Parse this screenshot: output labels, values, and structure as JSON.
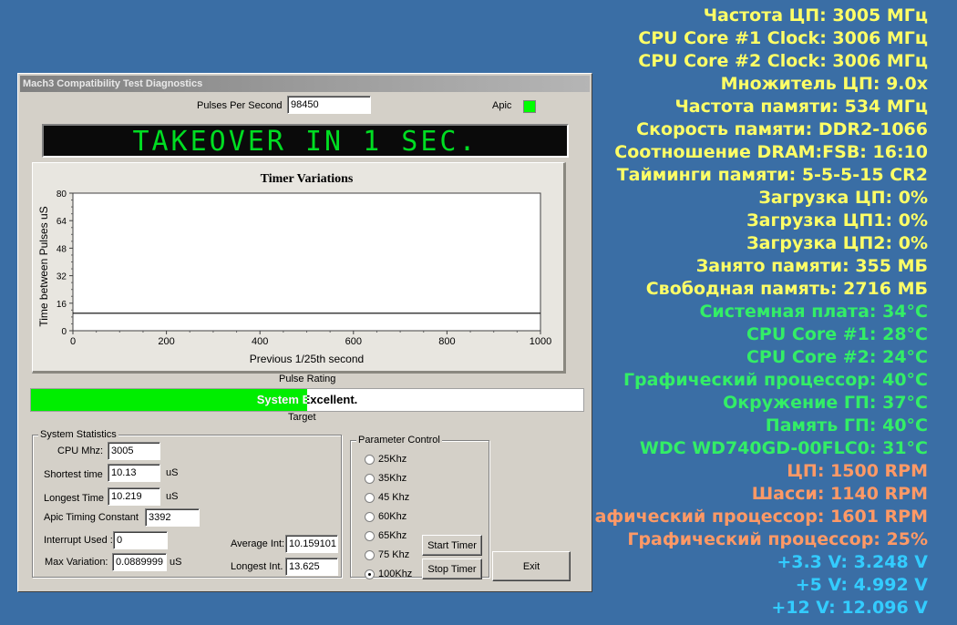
{
  "overlay": {
    "lines": [
      {
        "text": "Частота ЦП: 3005 МГц",
        "color": "#ffff66"
      },
      {
        "text": "CPU Core #1 Clock: 3006 МГц",
        "color": "#ffff66"
      },
      {
        "text": "CPU Core #2 Clock: 3006 МГц",
        "color": "#ffff66"
      },
      {
        "text": "Множитель ЦП: 9.0x",
        "color": "#ffff66"
      },
      {
        "text": "Частота памяти: 534 МГц",
        "color": "#ffff66"
      },
      {
        "text": "Скорость памяти: DDR2-1066",
        "color": "#ffff66"
      },
      {
        "text": "Соотношение DRAM:FSB: 16:10",
        "color": "#ffff66"
      },
      {
        "text": "Тайминги памяти: 5-5-5-15 CR2",
        "color": "#ffff66"
      },
      {
        "text": "Загрузка ЦП: 0%",
        "color": "#ffff66"
      },
      {
        "text": "Загрузка ЦП1: 0%",
        "color": "#ffff66"
      },
      {
        "text": "Загрузка ЦП2: 0%",
        "color": "#ffff66"
      },
      {
        "text": "Занято памяти: 355 МБ",
        "color": "#ffff66"
      },
      {
        "text": "Свободная память: 2716 МБ",
        "color": "#ffff66"
      },
      {
        "text": "Системная плата: 34°C",
        "color": "#33ee66"
      },
      {
        "text": "CPU Core #1: 28°C",
        "color": "#33ee66"
      },
      {
        "text": "CPU Core #2: 24°C",
        "color": "#33ee66"
      },
      {
        "text": "Графический процессор: 40°C",
        "color": "#33ee66"
      },
      {
        "text": "Окружение ГП: 37°C",
        "color": "#33ee66"
      },
      {
        "text": "Память ГП: 40°C",
        "color": "#33ee66"
      },
      {
        "text": "WDC WD740GD-00FLC0: 31°C",
        "color": "#33ee66"
      },
      {
        "text": "ЦП: 1500 RPM",
        "color": "#ff9966"
      },
      {
        "text": "Шасси: 1140 RPM",
        "color": "#ff9966"
      },
      {
        "text": "афический процессор: 1601 RPM",
        "color": "#ff9966"
      },
      {
        "text": "Графический процессор: 25%",
        "color": "#ff9966"
      },
      {
        "text": "+3.3 V: 3.248 V",
        "color": "#33ccff"
      },
      {
        "text": "+5 V: 4.992 V",
        "color": "#33ccff"
      },
      {
        "text": "+12 V: 12.096 V",
        "color": "#33ccff"
      }
    ]
  },
  "window": {
    "title": "Mach3 Compatibility Test Diagnostics",
    "pulses_label": "Pulses Per Second",
    "pulses_value": "98450",
    "apic_label": "Apic",
    "apic_color": "#00ff00",
    "led_text": "TAKEOVER IN 1 SEC.",
    "led_color": "#00dd22",
    "pulse_rating_label": "Pulse Rating",
    "rating_text": "System Excellent.",
    "rating_fraction": 0.5,
    "target_label": "Target",
    "stats": {
      "title": "System Statistics",
      "cpu_mhz_label": "CPU Mhz:",
      "cpu_mhz": "3005",
      "shortest_label": "Shortest time",
      "shortest": "10.13",
      "shortest_unit": "uS",
      "longest_label": "Longest Time",
      "longest": "10.219",
      "longest_unit": "uS",
      "apic_const_label": "Apic Timing Constant",
      "apic_const": "3392",
      "interrupt_label": "Interrupt Used :",
      "interrupt": "0",
      "maxvar_label": "Max Variation:",
      "maxvar": "0.0889999",
      "maxvar_unit": "uS",
      "avg_int_label": "Average Int:",
      "avg_int": "10.159101",
      "longest_int_label": "Longest Int.",
      "longest_int": "13.625"
    },
    "params": {
      "title": "Parameter Control",
      "options": [
        "25Khz",
        "35Khz",
        "45 Khz",
        "60Khz",
        "65Khz",
        "75 Khz",
        "100Khz"
      ],
      "selected_index": 6
    },
    "buttons": {
      "start": "Start Timer",
      "stop": "Stop Timer",
      "exit": "Exit"
    }
  },
  "chart_data": {
    "type": "line",
    "title": "Timer Variations",
    "xlabel": "Previous 1/25th second",
    "ylabel": "Time between Pulses uS",
    "xlim": [
      0,
      1000
    ],
    "ylim": [
      0,
      80
    ],
    "x_ticks": [
      0,
      200,
      400,
      600,
      800,
      1000
    ],
    "y_ticks": [
      0,
      16,
      32,
      48,
      64,
      80
    ],
    "series": [
      {
        "x": [
          0,
          1000
        ],
        "values": [
          10.16,
          10.16
        ]
      }
    ]
  }
}
